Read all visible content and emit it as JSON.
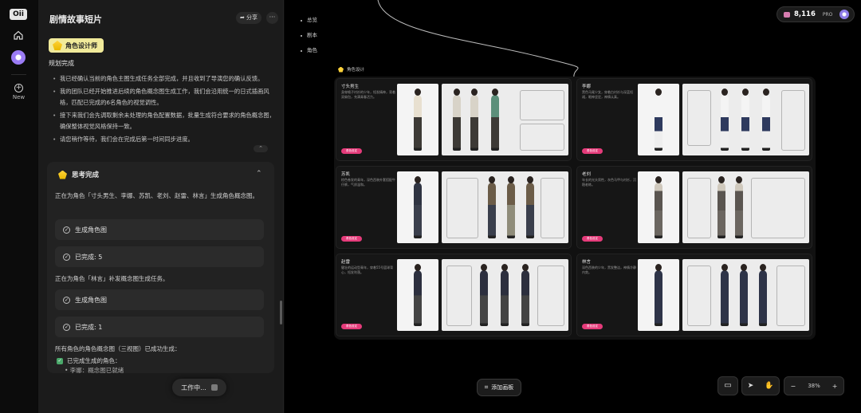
{
  "rail": {
    "logo": "Oii",
    "new_label": "New"
  },
  "chat": {
    "title": "剧情故事短片",
    "share_label": "分享",
    "more_label": "···",
    "role_chip": "角色设计师",
    "plan_title": "规划完成",
    "plan_items": [
      "我已经确认当前的角色主图生成任务全部完成，并且收到了导演您的确认反馈。",
      "我的团队已经开始推进后续的角色概念图生成工作，我们会沿用统一的日式插画风格，匹配已完成的6名角色的视觉调性。",
      "接下来我们会先调取剩余未处理的角色配置数据，批量生成符合要求的角色概念图，确保整体视觉风格保持一致。",
      "请您稍作等待，我们会在完成后第一时间同步进度。"
    ],
    "think": {
      "title": "思考完成",
      "text1": "正在为角色「寸头男生、李娜、苏凯、老刘、赵雷、林言」生成角色概念图。",
      "step1": "生成角色图",
      "step2": "已完成: 5",
      "text2": "正在为角色「林言」补发概念图生成任务。",
      "step3": "生成角色图",
      "step4": "已完成: 1",
      "text3": "所有角色的角色概念图（三视图）已成功生成：",
      "done_head": "已完成生成的角色：",
      "done_sub": "• 李娜：概念图已就绪"
    },
    "working_label": "工作中..."
  },
  "canvas": {
    "nav": [
      "总览",
      "剧本",
      "角色"
    ],
    "credits": {
      "value": "8,116",
      "tier": "PRO"
    },
    "board_label": "角色设计",
    "cards": [
      {
        "name": "寸头男生",
        "desc": "身穿格子衬衫的少年，短发精神，背着双肩包，充满青春活力。",
        "button": "角色设定"
      },
      {
        "name": "李娜",
        "desc": "黑色马尾少女，穿着白衬衫与深蓝短裙，眼神坚定，神情认真。",
        "button": "角色设定"
      },
      {
        "name": "苏凯",
        "desc": "棕色卷发的青年，深色西装外套搭配牛仔裤，气质温和。",
        "button": "角色设定"
      },
      {
        "name": "老刘",
        "desc": "年长的光头男性，灰色马甲与衬衫，沉稳老练。",
        "button": "角色设定"
      },
      {
        "name": "赵雷",
        "desc": "健壮的运动型青年，穿着55号篮球背心，短发利落。",
        "button": "角色设定"
      },
      {
        "name": "林言",
        "desc": "深色西装的少年，黑发整洁，神情冷静内敛。",
        "button": "角色设定"
      }
    ],
    "add_board_label": "添加画板",
    "zoom": "38%"
  }
}
